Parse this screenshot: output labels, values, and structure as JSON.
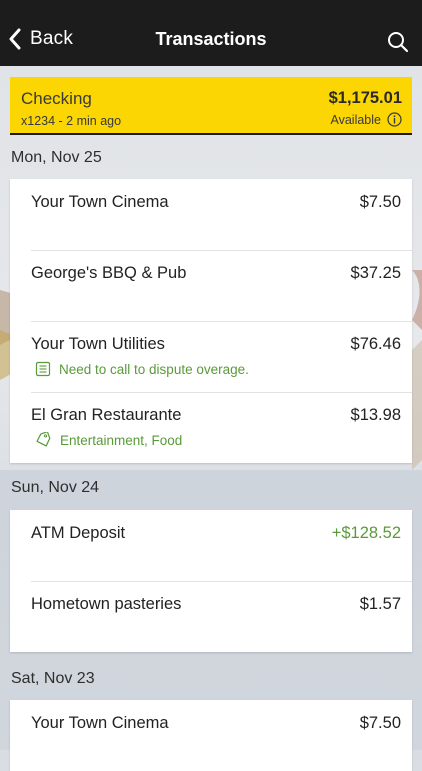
{
  "nav": {
    "back_label": "Back",
    "title": "Transactions"
  },
  "account": {
    "name": "Checking",
    "number": "x1234 - 2 min ago",
    "balance": "$1,175.01",
    "available_label": "Available",
    "accent_color": "#fbd602"
  },
  "groups": [
    {
      "date": "Mon, Nov 25",
      "transactions": [
        {
          "name": "Your Town Cinema",
          "amount": "$7.50"
        },
        {
          "name": "George's BBQ & Pub",
          "amount": "$37.25"
        },
        {
          "name": "Your Town Utilities",
          "amount": "$76.46",
          "note": "Need to call to dispute overage.",
          "note_icon": "note-icon"
        },
        {
          "name": "El Gran Restaurante",
          "amount": "$13.98",
          "note": "Entertainment, Food",
          "note_icon": "tag-icon"
        }
      ]
    },
    {
      "date": "Sun, Nov 24",
      "transactions": [
        {
          "name": "ATM Deposit",
          "amount": "+$128.52",
          "amount_color": "#5a9a3a"
        },
        {
          "name": "Hometown pasteries",
          "amount": "$1.57"
        }
      ]
    },
    {
      "date": "Sat, Nov 23",
      "transactions": [
        {
          "name": "Your Town Cinema",
          "amount": "$7.50"
        }
      ]
    }
  ]
}
